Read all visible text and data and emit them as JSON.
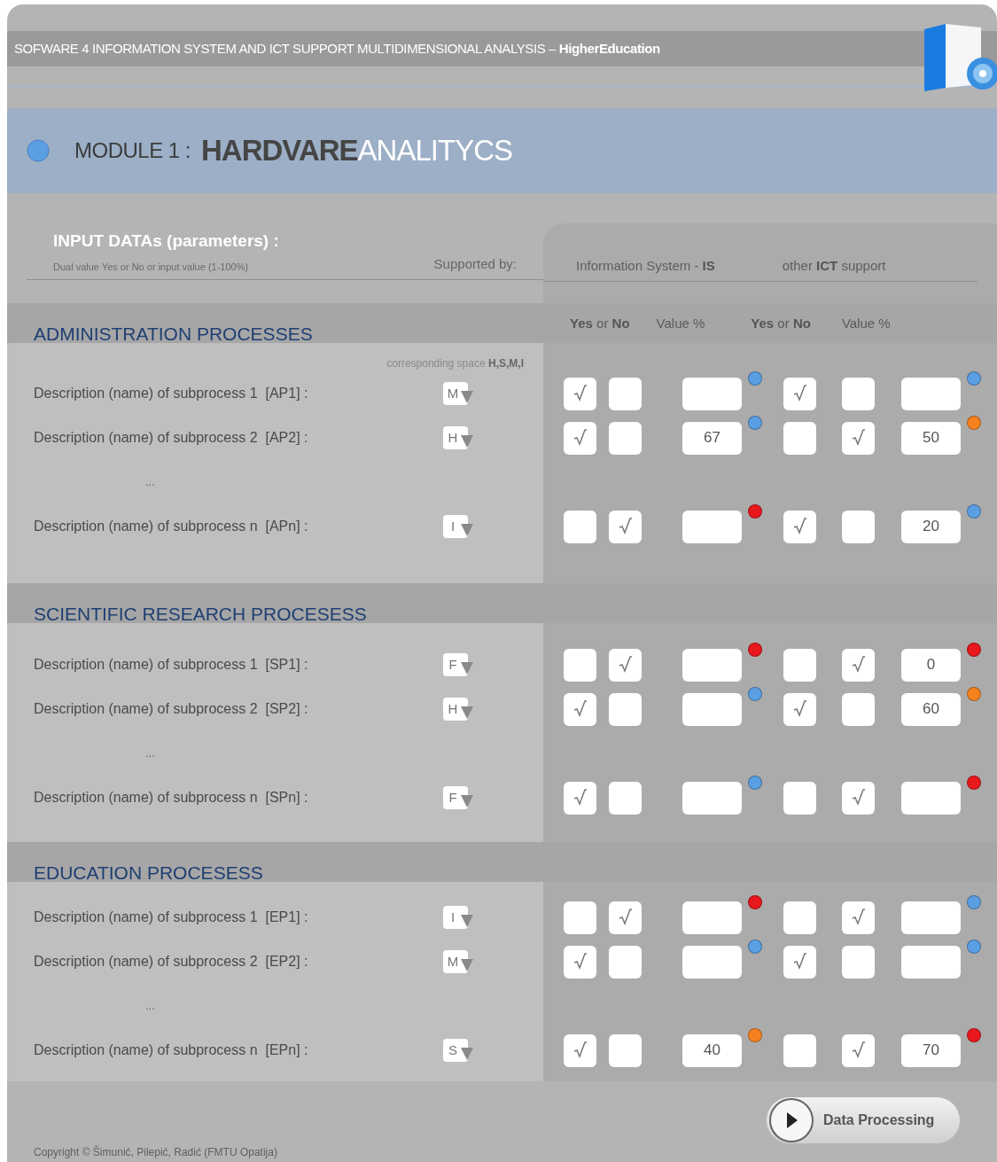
{
  "header": {
    "title": "SOFWARE 4 INFORMATION SYSTEM AND ICT SUPPORT MULTIDIMENSIONAL ANALYSIS – **HigherEducation**"
  },
  "module": {
    "label": "MODULE 1 :",
    "title": "**HARDVARE**ANALITYCS"
  },
  "input": {
    "title": "INPUT DATAs (parameters) :",
    "subtitle": "Dual value  Yes or No or input  value (1-100%)",
    "supported_by": "Supported by:",
    "groups": [
      "Information System - **IS**",
      "other **ICT** support"
    ]
  },
  "column_headers": [
    "**Yes** or **No**",
    "Value %",
    "**Yes** or **No**",
    "Value %"
  ],
  "sections": [
    {
      "title": "ADMINISTRATION PROCESSES",
      "caption": "corresponding space **H,S,M,I**",
      "rows": [
        {
          "kind": "subprocess",
          "label": "Description (name) of subprocess 1  [AP1] :",
          "space": "M",
          "is": {
            "yes": true,
            "no": false,
            "color": "#5b9fe3"
          },
          "ict": {
            "yes": true,
            "no": false,
            "color": "#5b9fe3"
          }
        },
        {
          "kind": "subprocess",
          "label": "Description (name) of subprocess 2  [AP2] :",
          "space": "H",
          "is": {
            "yes": true,
            "no": false,
            "value": "67",
            "color": "#5b9fe3"
          },
          "ict": {
            "yes": false,
            "no": true,
            "value": "50",
            "color": "#f5821f"
          }
        },
        {
          "kind": "ellipsis",
          "text": "..."
        },
        {
          "kind": "subprocess",
          "label": "Description (name) of subprocess n  [APn] :",
          "space": "I",
          "is": {
            "yes": false,
            "no": true,
            "color": "#e8181c"
          },
          "ict": {
            "yes": true,
            "no": false,
            "value": "20",
            "color": "#5b9fe3"
          }
        }
      ]
    },
    {
      "title": "SCIENTIFIC RESEARCH PROCESESS",
      "rows": [
        {
          "kind": "subprocess",
          "label": "Description (name) of subprocess 1  [SP1] :",
          "space": "F",
          "is": {
            "yes": false,
            "no": true,
            "color": "#e8181c"
          },
          "ict": {
            "yes": false,
            "no": true,
            "value": "0",
            "color": "#e8181c"
          }
        },
        {
          "kind": "subprocess",
          "label": "Description (name) of subprocess 2  [SP2] :",
          "space": "H",
          "is": {
            "yes": true,
            "no": false,
            "color": "#5b9fe3"
          },
          "ict": {
            "yes": true,
            "no": false,
            "value": "60",
            "color": "#f5821f"
          }
        },
        {
          "kind": "ellipsis",
          "text": "..."
        },
        {
          "kind": "subprocess",
          "label": "Description (name) of subprocess n  [SPn] :",
          "space": "F",
          "is": {
            "yes": true,
            "no": false,
            "color": "#5b9fe3"
          },
          "ict": {
            "yes": false,
            "no": true,
            "color": "#e8181c"
          }
        }
      ]
    },
    {
      "title": "EDUCATION PROCESESS",
      "rows": [
        {
          "kind": "subprocess",
          "label": "Description (name) of subprocess 1  [EP1] :",
          "space": "I",
          "is": {
            "yes": false,
            "no": true,
            "color": "#e8181c"
          },
          "ict": {
            "yes": false,
            "no": true,
            "color": "#5b9fe3"
          }
        },
        {
          "kind": "subprocess",
          "label": "Description (name) of subprocess 2  [EP2] :",
          "space": "M",
          "is": {
            "yes": true,
            "no": false,
            "color": "#5b9fe3"
          },
          "ict": {
            "yes": true,
            "no": false,
            "color": "#5b9fe3"
          }
        },
        {
          "kind": "ellipsis",
          "text": "..."
        },
        {
          "kind": "subprocess",
          "label": "Description (name) of subprocess n  [EPn] :",
          "space": "S",
          "is": {
            "yes": true,
            "no": false,
            "value": "40",
            "color": "#f5821f"
          },
          "ict": {
            "yes": false,
            "no": true,
            "value": "70",
            "color": "#e8181c"
          }
        }
      ]
    }
  ],
  "button": {
    "label": "Data  Processing"
  },
  "copyright": "Copyright  © Šimunić, Pilepić, Radić  (FMTU Opatija)"
}
